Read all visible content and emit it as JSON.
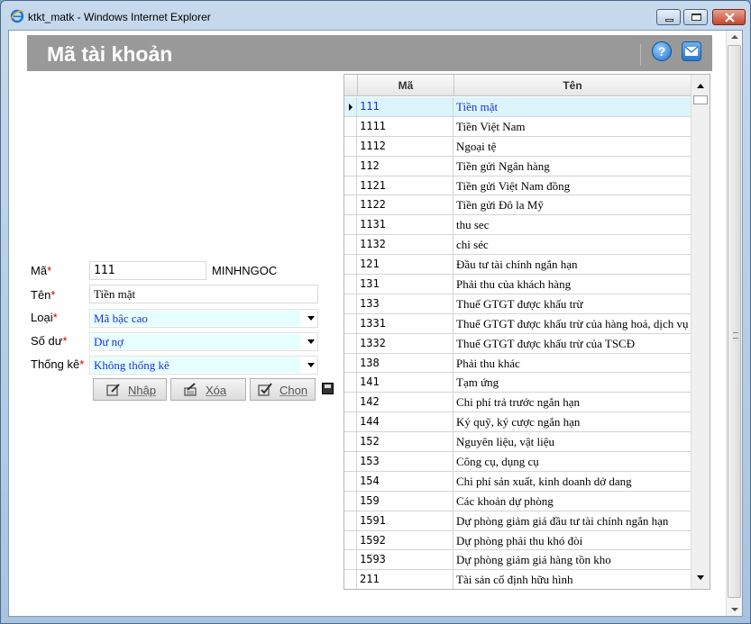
{
  "window": {
    "title": "ktkt_matk - Windows Internet Explorer"
  },
  "header": {
    "title": "Mã tài khoản",
    "help_icon": "help-icon",
    "mail_icon": "mail-icon"
  },
  "form": {
    "ma_label": "Mã",
    "ma_value": "111",
    "user": "MINHNGOC",
    "ten_label": "Tên",
    "ten_value": "Tiền mặt",
    "loai_label": "Loại",
    "loai_value": "Mã bậc cao",
    "sodu_label": "Số dư",
    "sodu_value": "Dư nợ",
    "thongke_label": "Thống kê",
    "thongke_value": "Không thống kê",
    "required_mark": "*"
  },
  "buttons": {
    "nhap": "Nhập",
    "xoa": "Xóa",
    "chon": "Chọn"
  },
  "grid": {
    "columns": [
      "Mã",
      "Tên"
    ],
    "selected_index": 0,
    "rows": [
      [
        "111",
        "Tiền mặt"
      ],
      [
        "1111",
        "Tiền Việt Nam"
      ],
      [
        "1112",
        "Ngoại tệ"
      ],
      [
        "112",
        "Tiền gửi Ngân hàng"
      ],
      [
        "1121",
        "Tiền gửi Việt Nam đồng"
      ],
      [
        "1122",
        "Tiền gửi Đô la Mỹ"
      ],
      [
        "1131",
        "thu sec"
      ],
      [
        "1132",
        "chi séc"
      ],
      [
        "121",
        "Đầu tư tài chính ngắn hạn"
      ],
      [
        "131",
        "Phải thu của khách hàng"
      ],
      [
        "133",
        "Thuế GTGT được khấu trừ"
      ],
      [
        "1331",
        "Thuế GTGT được khấu trừ của hàng hoá, dịch vụ"
      ],
      [
        "1332",
        "Thuế GTGT được khấu trừ của TSCĐ"
      ],
      [
        "138",
        "Phải thu khác"
      ],
      [
        "141",
        "Tạm ứng"
      ],
      [
        "142",
        "Chi phí trả trước ngắn hạn"
      ],
      [
        "144",
        "Ký quỹ, ký cược ngắn hạn"
      ],
      [
        "152",
        "Nguyên liệu, vật liệu"
      ],
      [
        "153",
        "Công cụ, dụng cụ"
      ],
      [
        "154",
        "Chi phí sản xuất, kinh doanh dở dang"
      ],
      [
        "159",
        "Các khoản dự phòng"
      ],
      [
        "1591",
        "Dự phòng giảm giá đầu tư tài chính ngắn hạn"
      ],
      [
        "1592",
        "Dự phòng phải thu khó đòi"
      ],
      [
        "1593",
        "Dự phòng giảm giá hàng tồn kho"
      ],
      [
        "211",
        "Tài sản cố định hữu hình"
      ]
    ]
  }
}
